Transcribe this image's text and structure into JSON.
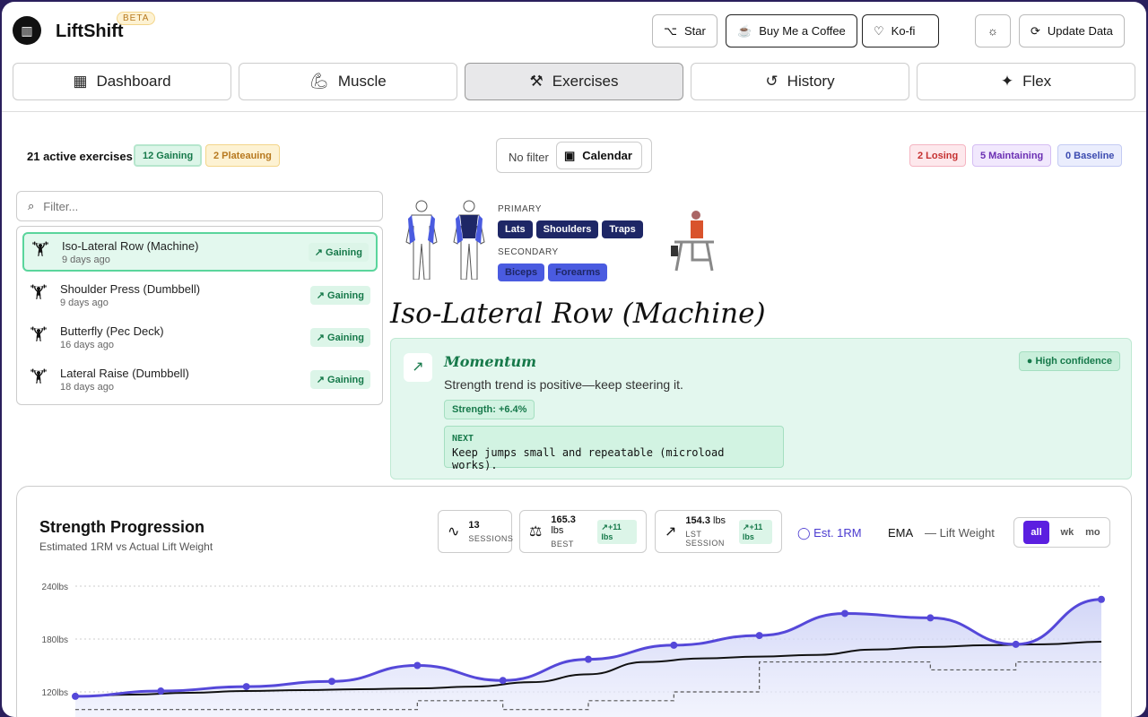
{
  "app": {
    "name": "LiftShift",
    "badge": "BETA"
  },
  "header": {
    "star": "Star",
    "coffee": "Buy Me a Coffee",
    "kofi": "Ko-fi",
    "update": "Update Data"
  },
  "tabs": [
    {
      "label": "Dashboard"
    },
    {
      "label": "Muscle"
    },
    {
      "label": "Exercises"
    },
    {
      "label": "History"
    },
    {
      "label": "Flex"
    }
  ],
  "summary": {
    "active": "21 active exercises",
    "gaining": "12 Gaining",
    "plateauing": "2 Plateauing",
    "losing": "2 Losing",
    "maintaining": "5 Maintaining",
    "baseline": "0 Baseline"
  },
  "filter": {
    "none": "No filter",
    "calendar": "Calendar"
  },
  "search": {
    "placeholder": "Filter..."
  },
  "exercises": [
    {
      "name": "Iso-Lateral Row (Machine)",
      "date": "9 days ago",
      "status": "Gaining"
    },
    {
      "name": "Shoulder Press (Dumbbell)",
      "date": "9 days ago",
      "status": "Gaining"
    },
    {
      "name": "Butterfly (Pec Deck)",
      "date": "16 days ago",
      "status": "Gaining"
    },
    {
      "name": "Lateral Raise (Dumbbell)",
      "date": "18 days ago",
      "status": "Gaining"
    }
  ],
  "detail": {
    "primary_label": "PRIMARY",
    "primary": [
      "Lats",
      "Shoulders",
      "Traps"
    ],
    "secondary_label": "SECONDARY",
    "secondary": [
      "Biceps",
      "Forearms"
    ],
    "title": "Iso-Lateral Row (Machine)"
  },
  "momentum": {
    "title": "Momentum",
    "text": "Strength trend is positive—keep steering it.",
    "confidence": "High confidence",
    "strength": "Strength: +6.4%",
    "next_label": "NEXT",
    "next": "Keep jumps small and repeatable (microload works)."
  },
  "stats": {
    "sessions": "13",
    "sessions_label": "SESSIONS",
    "best": "165.3",
    "best_unit": "lbs",
    "best_delta": "+11 lbs",
    "best_label": "BEST",
    "last": "154.3",
    "last_unit": "lbs",
    "last_delta": "+11 lbs",
    "last_label": "LST SESSION"
  },
  "legend": {
    "est": "Est. 1RM",
    "ema": "EMA",
    "lift": "Lift Weight"
  },
  "range": [
    "all",
    "wk",
    "mo"
  ],
  "chart_data": {
    "type": "line",
    "title": "Strength Progression",
    "subtitle": "Estimated 1RM vs Actual Lift Weight",
    "ylim": [
      110,
      245
    ],
    "yticks": [
      "240lbs",
      "180lbs",
      "120lbs"
    ],
    "ytick_values": [
      240,
      180,
      120
    ],
    "series": [
      {
        "name": "Est. 1RM",
        "values": [
          115,
          121,
          126,
          132,
          150,
          133,
          157,
          173,
          184,
          209,
          204,
          174,
          225
        ]
      },
      {
        "name": "EMA",
        "values": [
          115,
          117,
          119,
          121,
          122,
          123,
          124,
          126,
          131,
          140,
          154,
          158,
          160,
          162,
          168,
          171,
          173,
          174,
          177
        ]
      },
      {
        "name": "Lift Weight",
        "values": [
          100,
          100,
          100,
          100,
          110,
          100,
          110,
          120,
          154,
          154,
          145,
          154,
          154
        ]
      }
    ]
  }
}
